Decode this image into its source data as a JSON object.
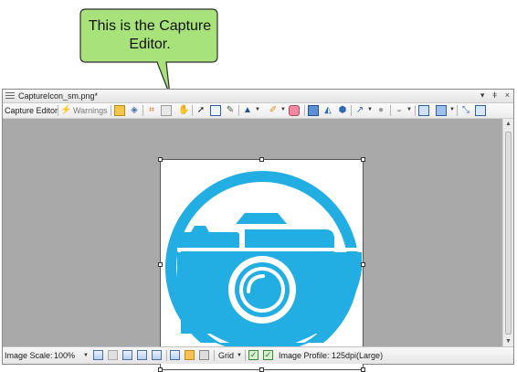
{
  "callout": {
    "line1": "This is the Capture",
    "line2": "Editor."
  },
  "window": {
    "title": "CaptureIcon_sm.png*",
    "buttons": [
      "▾",
      "ǂ",
      "×"
    ]
  },
  "toolbar": {
    "mode_label": "Capture Editor",
    "warnings_label": "Warnings"
  },
  "statusbar": {
    "scale_label": "Image Scale:",
    "scale_value": "100%",
    "grid_label": "Grid",
    "profile_label": "Image Profile: 125dpi(Large)"
  },
  "image": {
    "icon": "camera-icon",
    "accent_color": "#22aee3"
  },
  "colors": {
    "callout_fill": "#a8e27a",
    "canvas_bg": "#a9a9a9"
  }
}
